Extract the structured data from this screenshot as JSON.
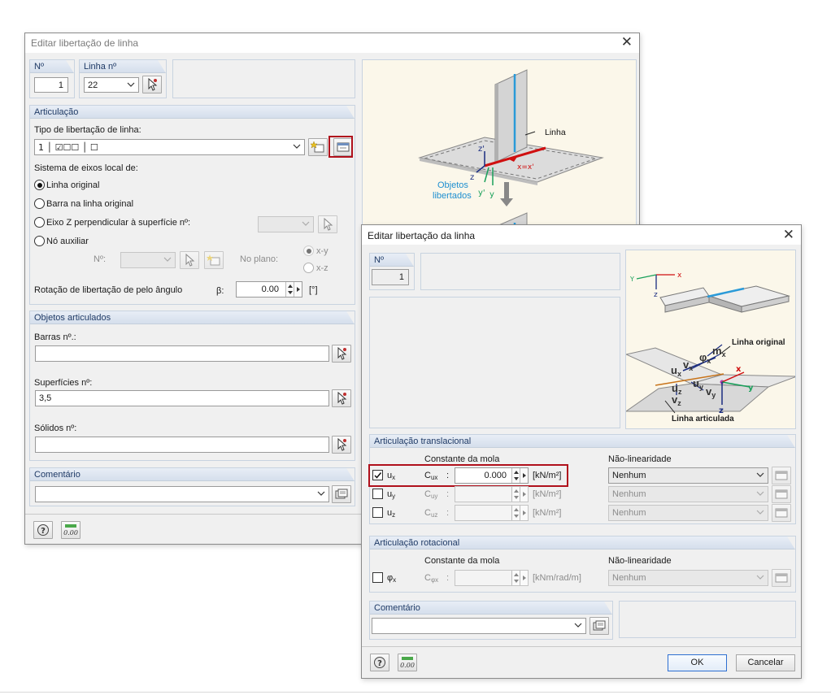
{
  "dlg1": {
    "title": "Editar libertação de linha",
    "no_label": "Nº",
    "no_value": "1",
    "line_label": "Linha nº",
    "line_value": "22",
    "articulation_header": "Articulação",
    "release_type_label": "Tipo de libertação de linha:",
    "release_type_value": "1 │ ☑☐☐ │ ☐",
    "local_axes_label": "Sistema de eixos local de:",
    "radio_original": "Linha original",
    "radio_bar": "Barra na linha original",
    "radio_axis_z": "Eixo Z perpendicular à superfície nº:",
    "radio_node": "Nó auxiliar",
    "node_no_label": "Nº:",
    "plane_label": "No plano:",
    "plane_xy": "x-y",
    "plane_xz": "x-z",
    "rotation_label": "Rotação de libertação de pelo ângulo",
    "beta_label": "β:",
    "rotation_value": "0.00",
    "rotation_unit": "[°]",
    "objects_header": "Objetos articulados",
    "bars_label": "Barras nº.:",
    "bars_value": "",
    "surfaces_label": "Superfícies nº:",
    "surfaces_value": "3,5",
    "solids_label": "Sólidos nº:",
    "solids_value": "",
    "comment_header": "Comentário",
    "comment_value": "",
    "image": {
      "line_label": "Linha",
      "objects_label_1": "Objetos",
      "objects_label_2": "libertados",
      "z_prime": "z'",
      "z": "z",
      "y_prime": "y'",
      "y": "y",
      "x_label": "x=x'"
    }
  },
  "dlg2": {
    "title": "Editar libertação da linha",
    "no_label": "Nº",
    "no_value": "1",
    "image": {
      "x": "x",
      "y": "Y",
      "z": "z",
      "linha_original": "Linha original",
      "linha_articulada": "Linha articulada",
      "ux": "u",
      "uz": "u",
      "uy": "u",
      "vx": "v",
      "vz": "v",
      "vy": "v",
      "phix": "φ",
      "mx": "m",
      "sub_x": "x",
      "sub_y": "y",
      "sub_z": "z",
      "ax_x": "x",
      "ax_y": "y",
      "ax_z": "z"
    },
    "translational_header": "Articulação translacional",
    "spring_const_label": "Constante da mola",
    "nonlinearity_label": "Não-linearidade",
    "ux": {
      "label": "u",
      "sub": "x",
      "c_label": "C",
      "c_sub": "ux",
      "value": "0.000",
      "unit": "[kN/m²]",
      "nonlin": "Nenhum",
      "checked": true
    },
    "uy": {
      "label": "u",
      "sub": "y",
      "c_label": "C",
      "c_sub": "uy",
      "value": "",
      "unit": "[kN/m²]",
      "nonlin": "Nenhum",
      "checked": false
    },
    "uz": {
      "label": "u",
      "sub": "z",
      "c_label": "C",
      "c_sub": "uz",
      "value": "",
      "unit": "[kN/m²]",
      "nonlin": "Nenhum",
      "checked": false
    },
    "rotational_header": "Articulação rotacional",
    "phix": {
      "label": "φ",
      "sub": "x",
      "c_label": "C",
      "c_sub": "φx",
      "value": "",
      "unit": "[kNm/rad/m]",
      "nonlin": "Nenhum",
      "checked": false
    },
    "comment_header": "Comentário",
    "comment_value": "",
    "ok_label": "OK",
    "cancel_label": "Cancelar"
  },
  "icons": {
    "help": "help-icon",
    "units": "units-icon",
    "pick": "pick-cursor-icon",
    "new": "new-object-icon",
    "edit": "edit-dialog-icon",
    "library": "library-icon"
  }
}
